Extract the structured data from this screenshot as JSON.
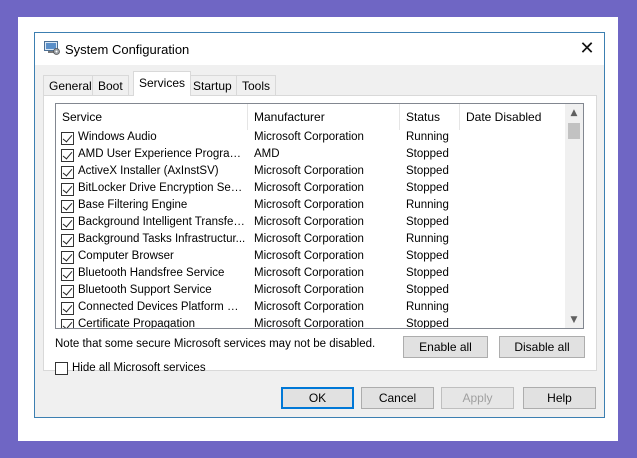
{
  "window": {
    "title": "System Configuration",
    "close_glyph": "✕"
  },
  "tabs": [
    {
      "label": "General",
      "active": false
    },
    {
      "label": "Boot",
      "active": false
    },
    {
      "label": "Services",
      "active": true
    },
    {
      "label": "Startup",
      "active": false
    },
    {
      "label": "Tools",
      "active": false
    }
  ],
  "services": {
    "columns": [
      "Service",
      "Manufacturer",
      "Status",
      "Date Disabled"
    ],
    "rows": [
      {
        "checked": true,
        "service": "Windows Audio",
        "manufacturer": "Microsoft Corporation",
        "status": "Running",
        "date_disabled": ""
      },
      {
        "checked": true,
        "service": "AMD User Experience Program L...",
        "manufacturer": "AMD",
        "status": "Stopped",
        "date_disabled": ""
      },
      {
        "checked": true,
        "service": "ActiveX Installer (AxInstSV)",
        "manufacturer": "Microsoft Corporation",
        "status": "Stopped",
        "date_disabled": ""
      },
      {
        "checked": true,
        "service": "BitLocker Drive Encryption Service",
        "manufacturer": "Microsoft Corporation",
        "status": "Stopped",
        "date_disabled": ""
      },
      {
        "checked": true,
        "service": "Base Filtering Engine",
        "manufacturer": "Microsoft Corporation",
        "status": "Running",
        "date_disabled": ""
      },
      {
        "checked": true,
        "service": "Background Intelligent Transfer ...",
        "manufacturer": "Microsoft Corporation",
        "status": "Stopped",
        "date_disabled": ""
      },
      {
        "checked": true,
        "service": "Background Tasks Infrastructur...",
        "manufacturer": "Microsoft Corporation",
        "status": "Running",
        "date_disabled": ""
      },
      {
        "checked": true,
        "service": "Computer Browser",
        "manufacturer": "Microsoft Corporation",
        "status": "Stopped",
        "date_disabled": ""
      },
      {
        "checked": true,
        "service": "Bluetooth Handsfree Service",
        "manufacturer": "Microsoft Corporation",
        "status": "Stopped",
        "date_disabled": ""
      },
      {
        "checked": true,
        "service": "Bluetooth Support Service",
        "manufacturer": "Microsoft Corporation",
        "status": "Stopped",
        "date_disabled": ""
      },
      {
        "checked": true,
        "service": "Connected Devices Platform Ser...",
        "manufacturer": "Microsoft Corporation",
        "status": "Running",
        "date_disabled": ""
      },
      {
        "checked": true,
        "service": "Certificate Propagation",
        "manufacturer": "Microsoft Corporation",
        "status": "Stopped",
        "date_disabled": ""
      }
    ],
    "scroll_up_glyph": "▲",
    "scroll_down_glyph": "▼"
  },
  "note": "Note that some secure Microsoft services may not be disabled.",
  "enable_all_label": "Enable all",
  "disable_all_label": "Disable all",
  "hide_ms_label": "Hide all Microsoft services",
  "hide_ms_checked": false,
  "buttons": {
    "ok": "OK",
    "cancel": "Cancel",
    "apply": "Apply",
    "help": "Help"
  },
  "colors": {
    "background": "#6f66c4",
    "accent": "#0078d7",
    "window_border": "#3c7fb1"
  }
}
